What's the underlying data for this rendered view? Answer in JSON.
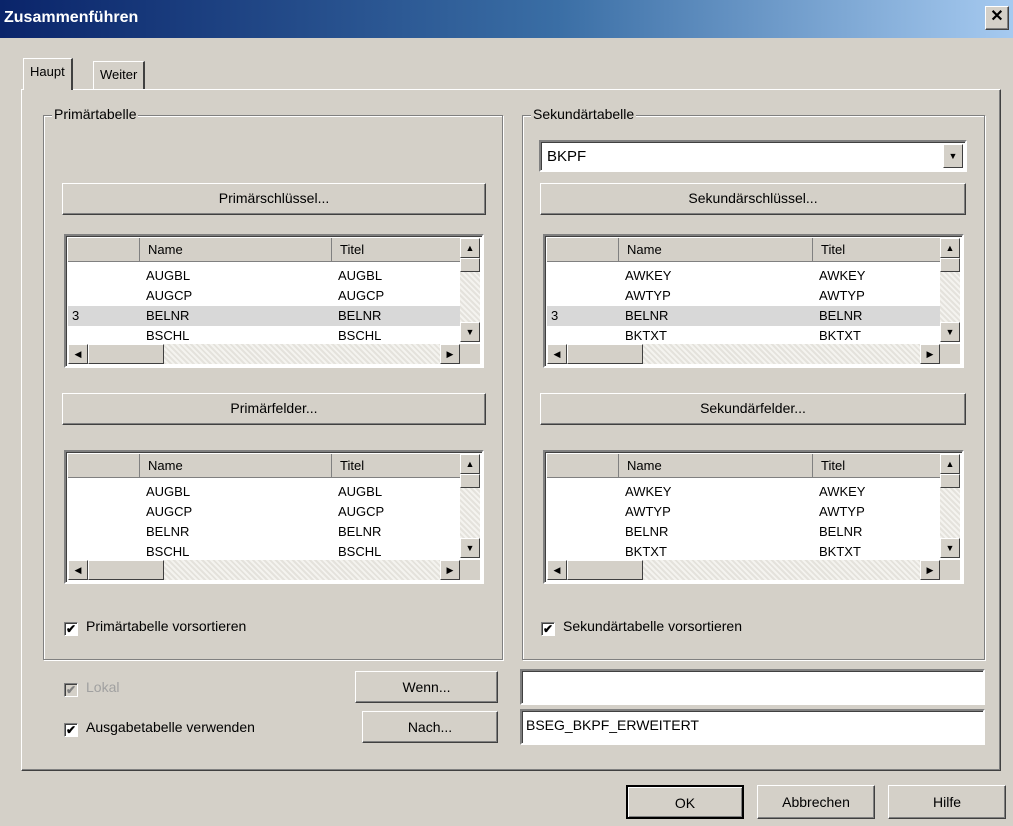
{
  "window": {
    "title": "Zusammenführen",
    "close_glyph": "✕"
  },
  "tabs": [
    {
      "label": "Haupt",
      "active": true
    },
    {
      "label": "Weiter",
      "active": false
    }
  ],
  "primary": {
    "group_label": "Primärtabelle",
    "key_button": "Primärschlüssel...",
    "fields_button": "Primärfelder...",
    "key_grid": {
      "columns": [
        "",
        "Name",
        "Titel"
      ],
      "rows": [
        {
          "index": "",
          "name": "AUGBL",
          "title": "AUGBL",
          "selected": false
        },
        {
          "index": "",
          "name": "AUGCP",
          "title": "AUGCP",
          "selected": false
        },
        {
          "index": "3",
          "name": "BELNR",
          "title": "BELNR",
          "selected": true
        },
        {
          "index": "",
          "name": "BSCHL",
          "title": "BSCHL",
          "selected": false
        }
      ]
    },
    "fields_grid": {
      "columns": [
        "",
        "Name",
        "Titel"
      ],
      "rows": [
        {
          "index": "",
          "name": "AUGBL",
          "title": "AUGBL",
          "selected": false
        },
        {
          "index": "",
          "name": "AUGCP",
          "title": "AUGCP",
          "selected": false
        },
        {
          "index": "",
          "name": "BELNR",
          "title": "BELNR",
          "selected": false
        },
        {
          "index": "",
          "name": "BSCHL",
          "title": "BSCHL",
          "selected": false
        }
      ]
    },
    "presort_label": "Primärtabelle vorsortieren",
    "presort_checked": true
  },
  "secondary": {
    "group_label": "Sekundärtabelle",
    "table_select": "BKPF",
    "key_button": "Sekundärschlüssel...",
    "fields_button": "Sekundärfelder...",
    "key_grid": {
      "columns": [
        "",
        "Name",
        "Titel"
      ],
      "rows": [
        {
          "index": "",
          "name": "AWKEY",
          "title": "AWKEY",
          "selected": false
        },
        {
          "index": "",
          "name": "AWTYP",
          "title": "AWTYP",
          "selected": false
        },
        {
          "index": "3",
          "name": "BELNR",
          "title": "BELNR",
          "selected": true
        },
        {
          "index": "",
          "name": "BKTXT",
          "title": "BKTXT",
          "selected": false
        }
      ]
    },
    "fields_grid": {
      "columns": [
        "",
        "Name",
        "Titel"
      ],
      "rows": [
        {
          "index": "",
          "name": "AWKEY",
          "title": "AWKEY",
          "selected": false
        },
        {
          "index": "",
          "name": "AWTYP",
          "title": "AWTYP",
          "selected": false
        },
        {
          "index": "",
          "name": "BELNR",
          "title": "BELNR",
          "selected": false
        },
        {
          "index": "",
          "name": "BKTXT",
          "title": "BKTXT",
          "selected": false
        }
      ]
    },
    "presort_label": "Sekundärtabelle vorsortieren",
    "presort_checked": true
  },
  "options": {
    "local_label": "Lokal",
    "local_checked": true,
    "local_disabled": true,
    "output_label": "Ausgabetabelle verwenden",
    "output_checked": true,
    "if_button": "Wenn...",
    "if_value": "",
    "to_button": "Nach...",
    "to_value": "BSEG_BKPF_ERWEITERT"
  },
  "footer": {
    "ok": "OK",
    "cancel": "Abbrechen",
    "help": "Hilfe"
  },
  "icons": {
    "check": "✔",
    "arrow_up": "▲",
    "arrow_down": "▼",
    "arrow_left": "◀",
    "arrow_right": "▶"
  }
}
